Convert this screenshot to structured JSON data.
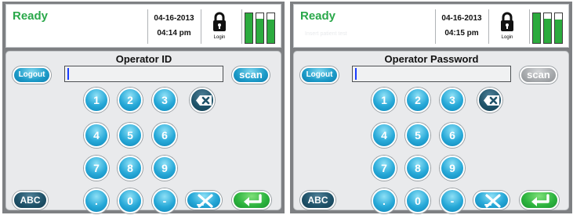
{
  "colors": {
    "accent_blue": "#1d9bc8",
    "dark_teal": "#1e5268",
    "green": "#2cab3e",
    "ready_text": "#2aa84a",
    "disabled_gray": "#a6a9ac"
  },
  "screens": [
    {
      "status": {
        "ready": "Ready",
        "ghost_text": "",
        "date": "04-16-2013",
        "time": "04:14 pm",
        "lock_label": "Login",
        "lock_icon": "padlock-icon",
        "battery_levels": [
          1.0,
          0.82,
          0.78
        ]
      },
      "prompt": "Operator ID",
      "field_value": "",
      "logout_label": "Logout",
      "scan_label": "scan",
      "scan_enabled": true,
      "keys": [
        "1",
        "2",
        "3",
        "4",
        "5",
        "6",
        "7",
        "8",
        "9",
        ".",
        "0",
        "-"
      ],
      "abc_label": "ABC",
      "backspace_icon": "backspace-icon",
      "clear_icon": "clear-icon",
      "enter_icon": "enter-icon"
    },
    {
      "status": {
        "ready": "Ready",
        "ghost_text": "Insert patient test",
        "date": "04-16-2013",
        "time": "04:15 pm",
        "lock_label": "Login",
        "lock_icon": "padlock-icon",
        "battery_levels": [
          1.0,
          0.82,
          0.78
        ]
      },
      "prompt": "Operator Password",
      "field_value": "",
      "logout_label": "Logout",
      "scan_label": "scan",
      "scan_enabled": false,
      "keys": [
        "1",
        "2",
        "3",
        "4",
        "5",
        "6",
        "7",
        "8",
        "9",
        ".",
        "0",
        "-"
      ],
      "abc_label": "ABC",
      "backspace_icon": "backspace-icon",
      "clear_icon": "clear-icon",
      "enter_icon": "enter-icon"
    }
  ]
}
